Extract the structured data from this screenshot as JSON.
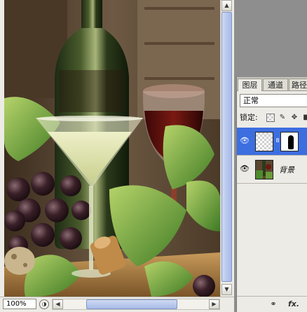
{
  "canvas": {
    "zoom": "100%",
    "image_description_icons": [
      "wine-bottle-icon",
      "wine-glass-icon",
      "martini-glass-icon",
      "grapes-icon",
      "cork-icon"
    ]
  },
  "layers_panel": {
    "tabs": [
      {
        "label": "图层",
        "active": true
      },
      {
        "label": "通道",
        "active": false
      },
      {
        "label": "路径",
        "active": false
      }
    ],
    "blend_mode": "正常",
    "lock_label": "锁定:",
    "layers": [
      {
        "name": "",
        "selected": true,
        "thumbnail": "transparent",
        "has_mask": true
      },
      {
        "name": "背景",
        "selected": false,
        "thumbnail": "photo",
        "has_mask": false
      }
    ],
    "footer_icons": [
      "link-icon",
      "fx-icon"
    ],
    "fx_label": "fx."
  },
  "colors": {
    "selection_blue": "#3d6ee0",
    "panel_bg": "#ecebe6",
    "workspace_gray": "#8e8e8e"
  }
}
